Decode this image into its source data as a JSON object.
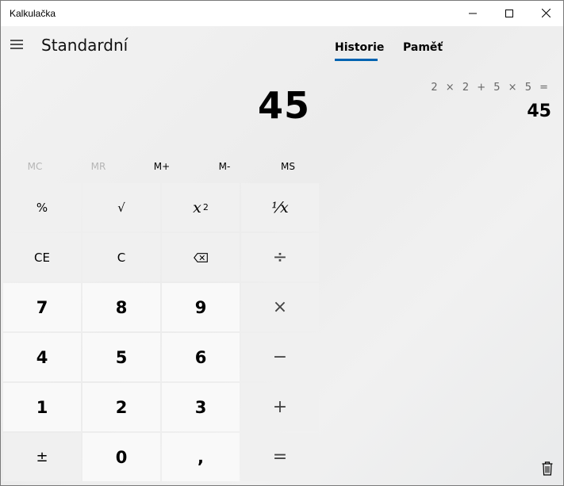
{
  "window": {
    "title": "Kalkulačka",
    "controls": [
      "minimize",
      "maximize",
      "close"
    ]
  },
  "header": {
    "menu_icon": "hamburger-icon",
    "mode": "Standardní"
  },
  "display": {
    "value": "45"
  },
  "memory": {
    "mc": "MC",
    "mr": "MR",
    "mplus": "M+",
    "mminus": "M-",
    "ms": "MS"
  },
  "keypad": {
    "percent": "%",
    "sqrt": "√",
    "square_base": "x",
    "square_exp": "2",
    "reciprocal": "⅟x",
    "ce": "CE",
    "c": "C",
    "backspace_icon": "backspace-icon",
    "divide": "÷",
    "n7": "7",
    "n8": "8",
    "n9": "9",
    "multiply": "×",
    "n4": "4",
    "n5": "5",
    "n6": "6",
    "minus": "−",
    "n1": "1",
    "n2": "2",
    "n3": "3",
    "plus": "+",
    "negate": "±",
    "n0": "0",
    "decimal": ",",
    "equals": "="
  },
  "panel": {
    "tabs": [
      "Historie",
      "Paměť"
    ],
    "active_tab": "Historie",
    "accent": "#0063b1",
    "history": [
      {
        "expression": "2 × 2 + 5 × 5 =",
        "result": "45"
      }
    ],
    "delete_icon": "trash-icon"
  }
}
